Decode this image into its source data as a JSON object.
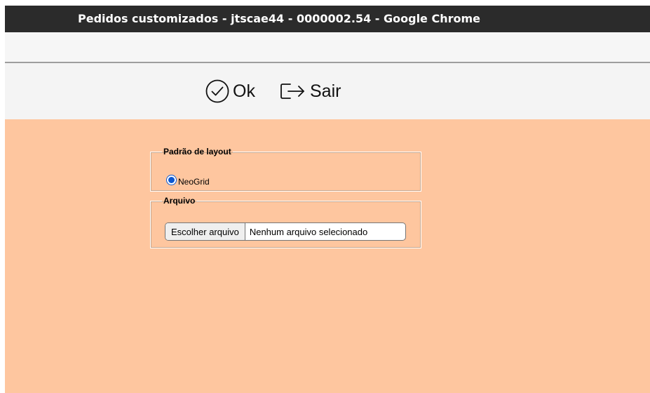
{
  "window": {
    "title": "Pedidos customizados - jtscae44 - 0000002.54 - Google Chrome"
  },
  "toolbar": {
    "ok_label": "Ok",
    "sair_label": "Sair"
  },
  "layout_group": {
    "legend": "Padrão de layout",
    "options": [
      {
        "label": "NeoGrid",
        "selected": true
      }
    ]
  },
  "file_group": {
    "legend": "Arquivo",
    "button_label": "Escolher arquivo",
    "status_text": "Nenhum arquivo selecionado"
  },
  "colors": {
    "content_background": "#fec69f",
    "title_bar": "#2b2b2b",
    "radio_accent": "#0b57d0"
  },
  "icons": {
    "ok": "check-circle-icon",
    "sair": "exit-arrow-icon"
  }
}
